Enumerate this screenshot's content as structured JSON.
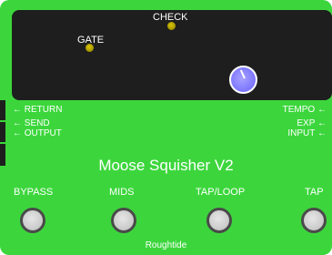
{
  "pedal": {
    "name": "Moose Squisher V2",
    "brand": "Roughtide",
    "body_color": "#3cd63c",
    "panel_color": "#1e1e1e",
    "knob_color": "#7b74ff",
    "led_color": "#c8b400"
  },
  "indicators": {
    "check_label": "CHECK",
    "gate_label": "GATE"
  },
  "ports": {
    "left": [
      "← RETURN",
      "← SEND",
      "← OUTPUT"
    ],
    "right": [
      "TEMPO ←",
      "EXP ←",
      "INPUT ←"
    ]
  },
  "footswitches": [
    {
      "label": "BYPASS"
    },
    {
      "label": "MIDS"
    },
    {
      "label": "TAP/LOOP"
    },
    {
      "label": "TAP"
    }
  ]
}
